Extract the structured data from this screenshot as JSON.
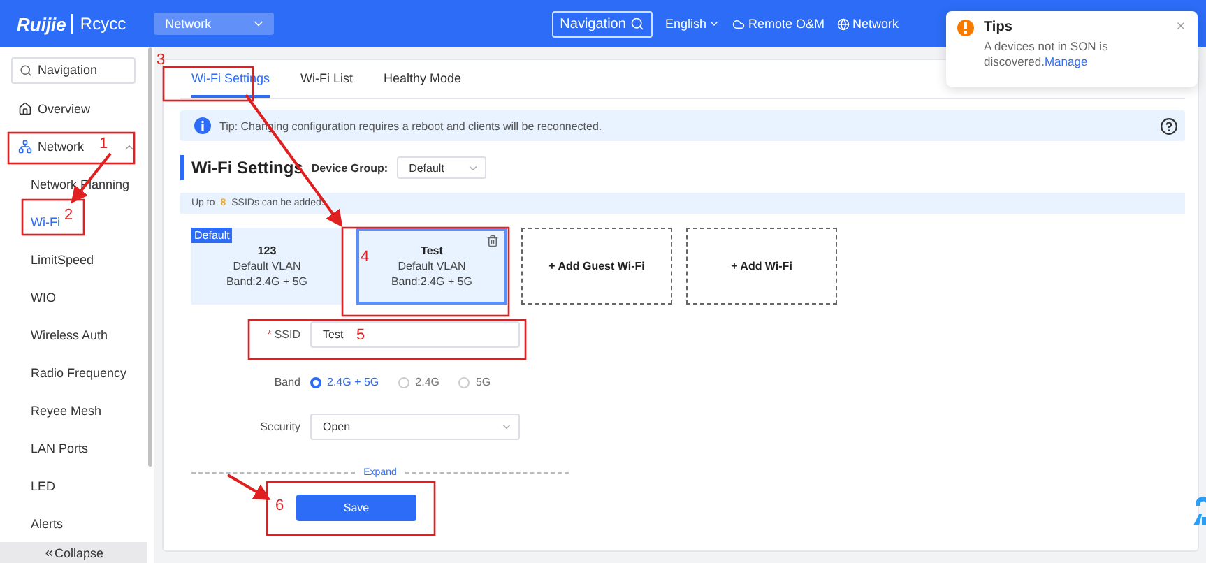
{
  "header": {
    "brand": "Ruijie",
    "product": "Rcycc",
    "network_select": "Network",
    "nav_search": "Navigation",
    "language": "English",
    "remote": "Remote O&M",
    "network_link": "Network"
  },
  "sidebar": {
    "search_placeholder": "Navigation",
    "items": [
      {
        "label": "Overview",
        "selected": false
      },
      {
        "label": "Network",
        "expanded": true,
        "selected": false,
        "children": [
          {
            "label": "Network Planning",
            "selected": false
          },
          {
            "label": "Wi-Fi",
            "selected": true
          },
          {
            "label": "LimitSpeed",
            "selected": false
          },
          {
            "label": "WIO",
            "selected": false
          },
          {
            "label": "Wireless Auth",
            "selected": false
          },
          {
            "label": "Radio Frequency",
            "selected": false
          },
          {
            "label": "Reyee Mesh",
            "selected": false
          },
          {
            "label": "LAN Ports",
            "selected": false
          },
          {
            "label": "LED",
            "selected": false
          },
          {
            "label": "Alerts",
            "selected": false
          }
        ]
      }
    ],
    "collapse": "Collapse"
  },
  "tabs": [
    {
      "label": "Wi-Fi Settings",
      "selected": true
    },
    {
      "label": "Wi-Fi List",
      "selected": false
    },
    {
      "label": "Healthy Mode",
      "selected": false
    }
  ],
  "tip": "Tip: Changing configuration requires a reboot and clients will be reconnected.",
  "section": {
    "title": "Wi-Fi Settings",
    "group_label": "Device Group:",
    "group_value": "Default"
  },
  "limit": {
    "prefix": "Up to",
    "count": "8",
    "suffix": "SSIDs can be added."
  },
  "cards": [
    {
      "kind": "ssid",
      "badge": "Default",
      "name": "123",
      "vlan": "Default VLAN",
      "band": "Band:2.4G + 5G",
      "selected": false
    },
    {
      "kind": "ssid",
      "name": "Test",
      "vlan": "Default VLAN",
      "band": "Band:2.4G + 5G",
      "selected": true
    },
    {
      "kind": "add",
      "label": "+ Add Guest Wi-Fi"
    },
    {
      "kind": "add",
      "label": "+ Add Wi-Fi"
    }
  ],
  "form": {
    "ssid_label": "SSID",
    "required_mark": "*",
    "ssid_value": "Test",
    "band_label": "Band",
    "band_options": [
      {
        "label": "2.4G + 5G",
        "selected": true
      },
      {
        "label": "2.4G",
        "selected": false
      },
      {
        "label": "5G",
        "selected": false
      }
    ],
    "security_label": "Security",
    "security_value": "Open"
  },
  "expand": "Expand",
  "save": "Save",
  "toast": {
    "title": "Tips",
    "message": "A devices not in SON is discovered.",
    "link": "Manage"
  },
  "annotations": [
    "1",
    "2",
    "3",
    "4",
    "5",
    "6"
  ]
}
